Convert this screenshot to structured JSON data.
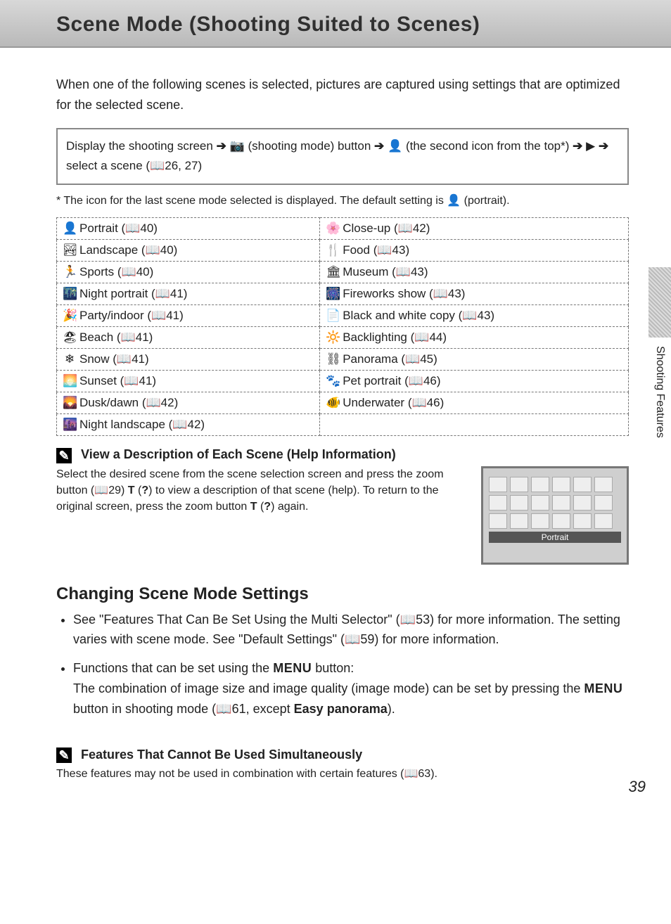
{
  "header": {
    "title": "Scene Mode (Shooting Suited to Scenes)"
  },
  "intro": "When one of the following scenes is selected, pictures are captured using settings that are optimized for the selected scene.",
  "nav_box": {
    "seg1": "Display the shooting screen",
    "camera": "📷",
    "seg2": "(shooting mode) button",
    "seg3": "(the second icon from the top*)",
    "seg4": "select a scene (",
    "bookref": "26, 27",
    "seg5": ")"
  },
  "footnote": "* The icon for the last scene mode selected is displayed. The default setting is",
  "footnote_tail": "(portrait).",
  "scene_table": {
    "left": [
      {
        "icon": "👤",
        "name": "Portrait",
        "page": "40"
      },
      {
        "icon": "🏞",
        "name": "Landscape",
        "page": "40"
      },
      {
        "icon": "🏃",
        "name": "Sports",
        "page": "40"
      },
      {
        "icon": "🌃",
        "name": "Night portrait",
        "page": "41"
      },
      {
        "icon": "🎉",
        "name": "Party/indoor",
        "page": "41"
      },
      {
        "icon": "🏖",
        "name": "Beach",
        "page": "41"
      },
      {
        "icon": "❄",
        "name": "Snow",
        "page": "41"
      },
      {
        "icon": "🌅",
        "name": "Sunset",
        "page": "41"
      },
      {
        "icon": "🌄",
        "name": "Dusk/dawn",
        "page": "42"
      },
      {
        "icon": "🌆",
        "name": "Night landscape",
        "page": "42"
      }
    ],
    "right": [
      {
        "icon": "🌸",
        "name": "Close-up",
        "page": "42"
      },
      {
        "icon": "🍴",
        "name": "Food",
        "page": "43"
      },
      {
        "icon": "🏛",
        "name": "Museum",
        "page": "43"
      },
      {
        "icon": "🎆",
        "name": "Fireworks show",
        "page": "43"
      },
      {
        "icon": "📄",
        "name": "Black and white copy",
        "page": "43"
      },
      {
        "icon": "🔆",
        "name": "Backlighting",
        "page": "44"
      },
      {
        "icon": "⛓",
        "name": "Panorama",
        "page": "45"
      },
      {
        "icon": "🐾",
        "name": "Pet portrait",
        "page": "46"
      },
      {
        "icon": "🐠",
        "name": "Underwater",
        "page": "46"
      },
      {
        "icon": "",
        "name": "",
        "page": ""
      }
    ]
  },
  "help_note": {
    "pencil": "✎",
    "title": "View a Description of Each Scene (Help Information)",
    "body1": "Select the desired scene from the scene selection screen and press the zoom button (",
    "ref1": "29",
    "body2": ")",
    "T": "T",
    "q": "?",
    "body3": "to view a description of that scene (help). To return to the original screen, press the zoom button",
    "body4": "again.",
    "thumb_label": "Portrait"
  },
  "changing": {
    "title": "Changing Scene Mode Settings",
    "items": [
      {
        "a": "See \"Features That Can Be Set Using the Multi Selector\" (",
        "ref1": "53",
        "b": ") for more information. The setting varies with scene mode. See \"Default Settings\" (",
        "ref2": "59",
        "c": ") for more information."
      },
      {
        "a": "Functions that can be set using the",
        "menu": "MENU",
        "b": "button:",
        "c": "The combination of image size and image quality (image mode) can be set by pressing the",
        "d": "button in shooting mode (",
        "ref": "61",
        "e": ", except",
        "bold": "Easy panorama",
        "f": ")."
      }
    ]
  },
  "cannot": {
    "pencil": "✎",
    "title": "Features That Cannot Be Used Simultaneously",
    "body": "These features may not be used in combination with certain features (",
    "ref": "63",
    "tail": ")."
  },
  "side_tab": "Shooting Features",
  "page_number": "39",
  "glyphs": {
    "arrow": "➔",
    "play": "▶",
    "book": "📖",
    "scene_icon": "👤"
  }
}
